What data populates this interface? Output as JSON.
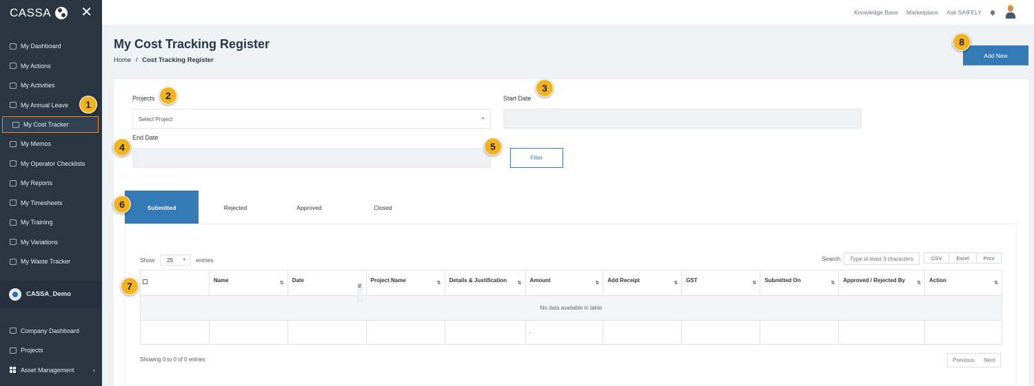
{
  "brand": {
    "name": "CASSA"
  },
  "sidebar": {
    "items": [
      {
        "label": "My Dashboard",
        "icon": "dashboard-icon"
      },
      {
        "label": "My Actions",
        "icon": "actions-icon"
      },
      {
        "label": "My Activities",
        "icon": "activities-icon"
      },
      {
        "label": "My Annual Leave",
        "icon": "leave-icon"
      },
      {
        "label": "My Cost Tracker",
        "icon": "cost-icon",
        "active": true
      },
      {
        "label": "My Memos",
        "icon": "memo-icon"
      },
      {
        "label": "My Operator Checklists",
        "icon": "checklist-icon"
      },
      {
        "label": "My Reports",
        "icon": "reports-icon"
      },
      {
        "label": "My Timesheets",
        "icon": "timesheet-icon"
      },
      {
        "label": "My Training",
        "icon": "training-icon"
      },
      {
        "label": "My Variations",
        "icon": "variations-icon"
      },
      {
        "label": "My Waste Tracker",
        "icon": "waste-icon"
      }
    ],
    "org": "CASSA_Demo",
    "company_items": [
      {
        "label": "Company Dashboard",
        "icon": "company-dashboard-icon"
      },
      {
        "label": "Projects",
        "icon": "projects-icon"
      },
      {
        "label": "Asset Management",
        "icon": "asset-icon",
        "chevron": "‹"
      }
    ]
  },
  "topbar": {
    "knowledge_base": "Knowledge Base",
    "marketplace": "Marketplace",
    "ask": "Ask SAIFELY"
  },
  "header": {
    "title": "My Cost Tracking Register",
    "breadcrumb_home": "Home",
    "breadcrumb_sep": "/",
    "breadcrumb_current": "Cost Tracking Register",
    "add_new": "Add New"
  },
  "filters": {
    "projects_label": "Projects",
    "projects_placeholder": "Select Project",
    "start_date_label": "Start Date",
    "end_date_label": "End Date",
    "filter_button": "Filter"
  },
  "tabs": [
    {
      "label": "Submitted",
      "active": true
    },
    {
      "label": "Rejected"
    },
    {
      "label": "Approved"
    },
    {
      "label": "Closed"
    }
  ],
  "table": {
    "show_label": "Show",
    "entries_label": "entries",
    "page_length": "25",
    "search_label": "Search:",
    "search_placeholder": "Type at least 3 characters",
    "export_buttons": [
      "CSV",
      "Excel",
      "Print"
    ],
    "columns": [
      "",
      "Name",
      "Date",
      "Project Name",
      "Details & Justification",
      "Amount",
      "Add Receipt",
      "GST",
      "Submitted On",
      "Approved / Rejected By",
      "Action"
    ],
    "empty_message": "No data available in table",
    "footer_amount": "-",
    "showing": "Showing 0 to 0 of 0 entries",
    "prev": "Previous",
    "next": "Next"
  },
  "callouts": [
    "1",
    "2",
    "3",
    "4",
    "5",
    "6",
    "7",
    "8"
  ],
  "colors": {
    "sidebar": "#2b3643",
    "primary": "#337ab7",
    "callout": "#f2b322",
    "active_border": "#e98a2f"
  }
}
